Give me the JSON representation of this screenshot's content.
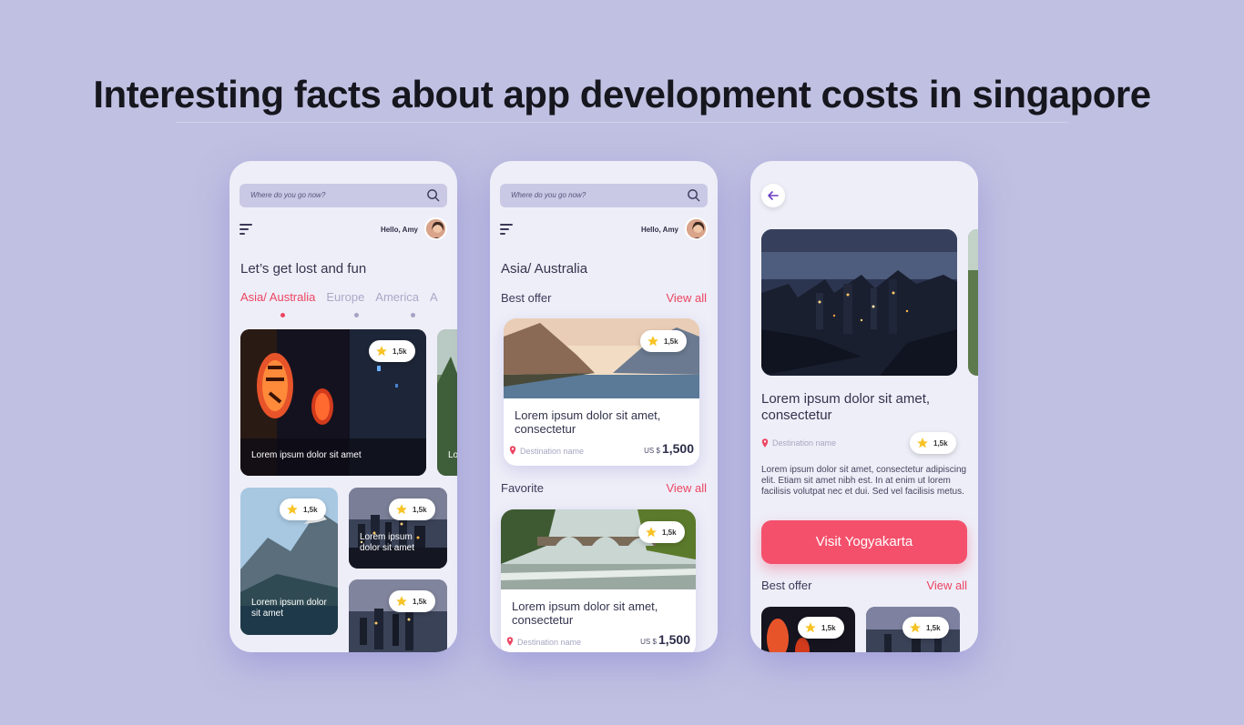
{
  "headline": "Interesting facts about app development costs in singapore",
  "screens": {
    "home": {
      "search_placeholder": "Where do you go now?",
      "greeting": "Hello, Amy",
      "title": "Let’s get lost and fun",
      "tabs": [
        "Asia/ Australia",
        "Europe",
        "America",
        "A"
      ],
      "cards": [
        {
          "caption": "Lorem ipsum dolor sit amet",
          "rating": "1,5k"
        },
        {
          "caption": "Lo",
          "rating": ""
        },
        {
          "caption": "Lorem ipsum dolor sit amet",
          "rating": "1,5k"
        },
        {
          "caption": "Lorem ipsum dolor sit amet",
          "rating": "1,5k"
        },
        {
          "caption": "",
          "rating": "1,5k"
        }
      ]
    },
    "region": {
      "search_placeholder": "Where do you go now?",
      "greeting": "Hello, Amy",
      "title": "Asia/ Australia",
      "best_offer": {
        "heading": "Best offer",
        "view_all": "View all",
        "title": "Lorem ipsum dolor sit amet, consectetur",
        "destination": "Destination name",
        "currency": "US $",
        "price": "1,500",
        "rating": "1,5k"
      },
      "favorite": {
        "heading": "Favorite",
        "view_all": "View all",
        "title": "Lorem ipsum dolor sit amet, consectetur",
        "destination": "Destination name",
        "currency": "US $",
        "price": "1,500",
        "rating": "1,5k"
      }
    },
    "detail": {
      "title": "Lorem ipsum dolor sit amet, consectetur",
      "destination": "Destination name",
      "rating": "1,5k",
      "description": "Lorem ipsum dolor sit amet, consectetur adipiscing elit. Etiam sit amet nibh est. In at enim ut lorem facilisis volutpat nec et dui. Sed vel facilisis metus.",
      "cta": "Visit Yogyakarta",
      "best_offer_heading": "Best offer",
      "view_all": "View all",
      "thumb_ratings": [
        "1,5k",
        "1,5k"
      ]
    }
  },
  "colors": {
    "background": "#c0c0e2",
    "accent": "#ec4461",
    "cta": "#f4506c",
    "card": "#ffffff",
    "screen": "#eeeef8"
  }
}
